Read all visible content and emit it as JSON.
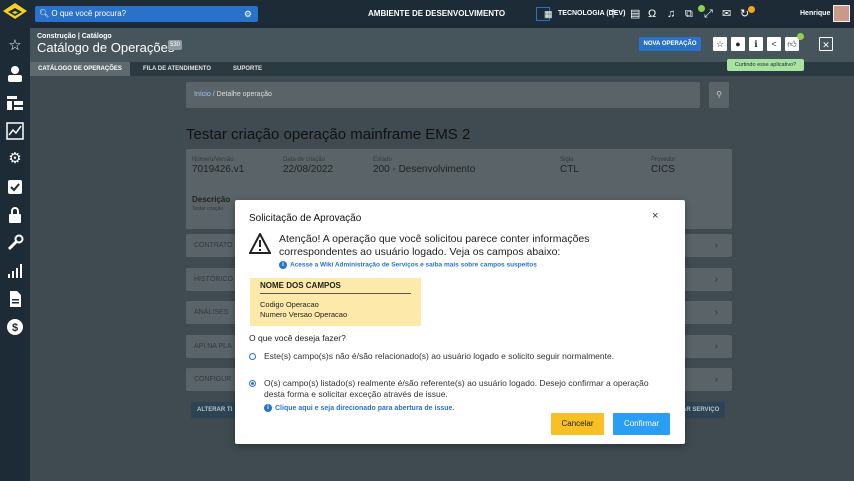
{
  "topbar": {
    "search_placeholder": "O que você procura?",
    "environment": "AMBIENTE DE DESENVOLVIMENTO",
    "context": "TECNOLOGIA (DEV)",
    "user_name": "Henrique"
  },
  "header": {
    "breadcrumb": "Construção | Catálogo",
    "title": "Catálogo de Operações",
    "count": "530",
    "new_operation": "NOVA OPERAÇÃO",
    "tooltip": "Curtindo esse aplicativo?"
  },
  "tabs": [
    {
      "label": "CATÁLOGO DE OPERAÇÕES",
      "active": true
    },
    {
      "label": "FILA DE ATENDIMENTO",
      "active": false
    },
    {
      "label": "SUPORTE",
      "active": false
    }
  ],
  "breadcrumb": {
    "home": "Início",
    "separator": "/",
    "current": "Detalhe operação"
  },
  "operation": {
    "title": "Testar criação operação mainframe EMS 2",
    "fields": [
      {
        "label": "Número/Versão",
        "value": "7019426.v1"
      },
      {
        "label": "Data de criação",
        "value": "22/08/2022"
      },
      {
        "label": "Estado",
        "value": "200 - Desenvolvimento"
      },
      {
        "label": "Sigla",
        "value": "CTL"
      },
      {
        "label": "Provedor",
        "value": "CICS"
      }
    ],
    "description_label": "Descrição",
    "description_value": "Testar criação"
  },
  "accordions": [
    "CONTRATO",
    "HISTÓRICO",
    "ANÁLISES",
    "API NA PLA",
    "CONFIGUR"
  ],
  "bottom_buttons": {
    "left": "ALTERAR TI",
    "right": "AR SERVIÇO"
  },
  "modal": {
    "title": "Solicitação de Aprovação",
    "close": "×",
    "warning": "Atenção! A operação que você solicitou parece conter informações correspondentes  ao usuário logado. Veja os campos abaixo:",
    "wiki_link": "Acesse a Wiki Administração de Serviços e saiba mais sobre campos suspeitos",
    "fields_header": "NOME DOS CAMPOS",
    "fields": [
      "Codigo Operacao",
      "Numero Versao Operacao"
    ],
    "question": "O que você deseja fazer?",
    "option_1": "Este(s) campo(s)s não é/são relacionado(s) ao usuário logado e solicito seguir normalmente.",
    "option_2": "O(s) campo(s) listado(s) realmente é/são referente(s) ao usuário logado. Desejo confirmar a operação desta forma e solicitar exceção através de issue.",
    "selected_option": 2,
    "issue_link": "Clique aqui e seja direcionado para abertura de issue.",
    "cancel": "Cancelar",
    "confirm": "Confirmar"
  },
  "colors": {
    "primary": "#2a72c9",
    "nav_bg": "#1c2b35",
    "warning_bg": "#fde9aa",
    "cancel_bg": "#f7c024",
    "confirm_bg": "#2a9df4"
  }
}
